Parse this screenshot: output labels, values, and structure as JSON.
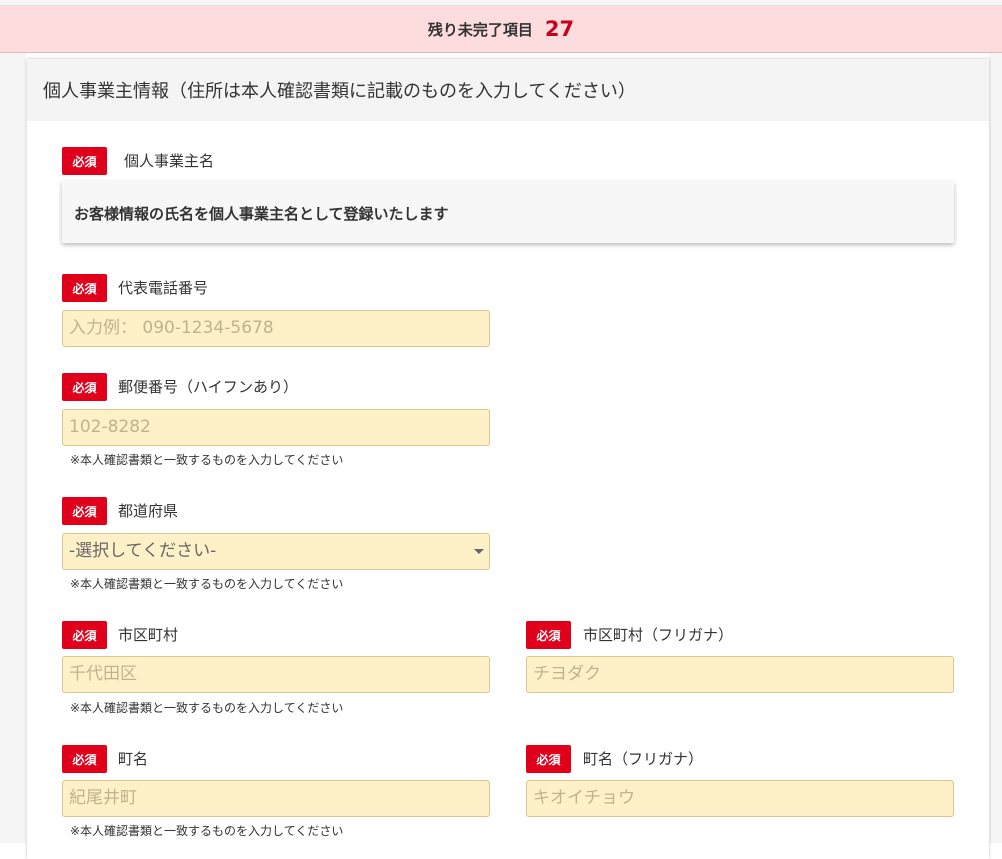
{
  "banner": {
    "label": "残り未完了項目",
    "count": "27"
  },
  "section": {
    "title": "個人事業主情報（住所は本人確認書類に記載のものを入力してください）"
  },
  "required_badge": "必須",
  "owner_name": {
    "label": "個人事業主名",
    "info": "お客様情報の氏名を個人事業主名として登録いたします"
  },
  "phone": {
    "label": "代表電話番号",
    "placeholder": "入力例： 090-1234-5678"
  },
  "postal": {
    "label": "郵便番号（ハイフンあり）",
    "placeholder": "102-8282",
    "note": "※本人確認書類と一致するものを入力してください"
  },
  "prefecture": {
    "label": "都道府県",
    "selected": "-選択してください-",
    "note": "※本人確認書類と一致するものを入力してください"
  },
  "city": {
    "label": "市区町村",
    "placeholder": "千代田区",
    "note": "※本人確認書類と一致するものを入力してください"
  },
  "city_kana": {
    "label": "市区町村（フリガナ）",
    "placeholder": "チヨダク"
  },
  "town": {
    "label": "町名",
    "placeholder": "紀尾井町",
    "note": "※本人確認書類と一致するものを入力してください"
  },
  "town_kana": {
    "label": "町名（フリガナ）",
    "placeholder": "キオイチョウ"
  },
  "colors": {
    "banner_bg": "#fcdcdc",
    "accent_red": "#e0001b",
    "count_red": "#c8001e",
    "input_bg": "#fef0c7",
    "input_border": "#d9c78f"
  }
}
